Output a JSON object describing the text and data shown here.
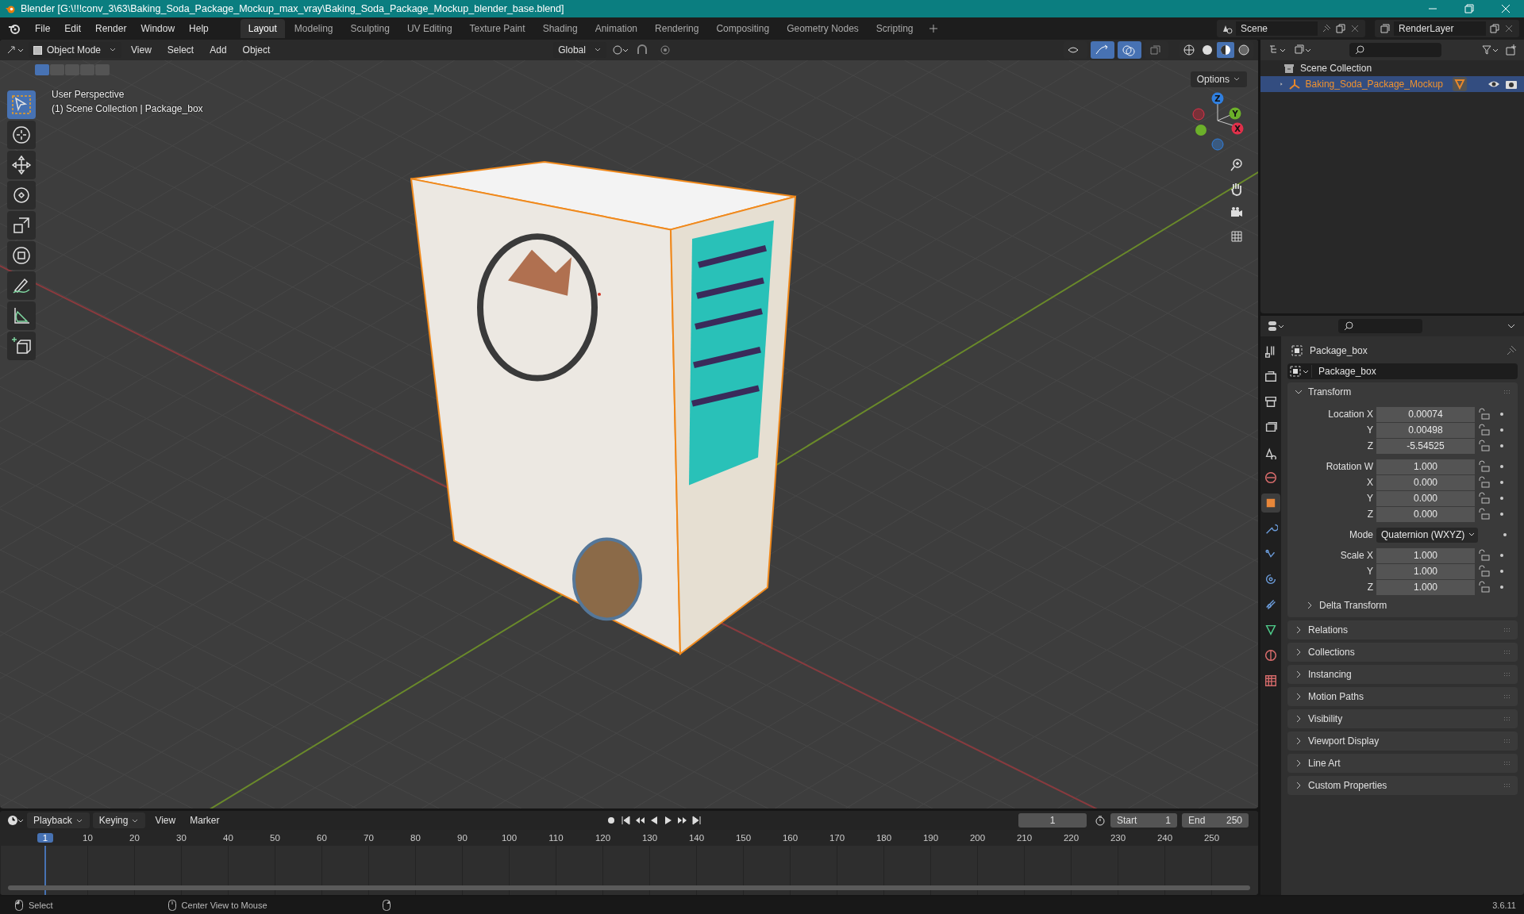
{
  "title_bar": {
    "title": "Blender [G:\\!!!conv_3\\63\\Baking_Soda_Package_Mockup_max_vray\\Baking_Soda_Package_Mockup_blender_base.blend]"
  },
  "menu": [
    "File",
    "Edit",
    "Render",
    "Window",
    "Help"
  ],
  "workspaces": [
    {
      "label": "Layout",
      "selected": true
    },
    {
      "label": "Modeling",
      "selected": false
    },
    {
      "label": "Sculpting",
      "selected": false
    },
    {
      "label": "UV Editing",
      "selected": false
    },
    {
      "label": "Texture Paint",
      "selected": false
    },
    {
      "label": "Shading",
      "selected": false
    },
    {
      "label": "Animation",
      "selected": false
    },
    {
      "label": "Rendering",
      "selected": false
    },
    {
      "label": "Compositing",
      "selected": false
    },
    {
      "label": "Geometry Nodes",
      "selected": false
    },
    {
      "label": "Scripting",
      "selected": false
    }
  ],
  "scene": {
    "name": "Scene"
  },
  "view_layer": {
    "name": "RenderLayer"
  },
  "viewport": {
    "mode": "Object Mode",
    "menus": [
      "View",
      "Select",
      "Add",
      "Object"
    ],
    "orientation": "Global",
    "options": "Options",
    "toggles": [
      {
        "kind": "visibility",
        "on": false
      },
      {
        "kind": "gizmo",
        "on": true
      },
      {
        "kind": "overlay",
        "on": true
      },
      {
        "kind": "xray",
        "on": false
      }
    ],
    "shading": [
      {
        "kind": "wireframe",
        "selected": false
      },
      {
        "kind": "solid",
        "selected": false
      },
      {
        "kind": "material",
        "selected": true
      },
      {
        "kind": "rendered",
        "selected": false
      }
    ],
    "select_modes": [
      {
        "selected": true
      },
      {
        "selected": false
      },
      {
        "selected": false
      },
      {
        "selected": false
      },
      {
        "selected": false
      }
    ],
    "overlay_text": [
      "User Perspective",
      "(1) Scene Collection | Package_box"
    ],
    "tools": [
      {
        "kind": "select",
        "selected": true
      },
      {
        "kind": "cursor",
        "selected": false
      },
      {
        "kind": "move",
        "selected": false
      },
      {
        "kind": "rotate",
        "selected": false
      },
      {
        "kind": "scale",
        "selected": false
      },
      {
        "kind": "transform",
        "selected": false
      },
      {
        "kind": "annotate",
        "selected": false
      },
      {
        "kind": "measure",
        "selected": false
      },
      {
        "kind": "add",
        "selected": false
      }
    ],
    "gizmo_axes": [
      "Z",
      "Y",
      "X"
    ]
  },
  "outliner": {
    "root": "Scene Collection",
    "items": [
      {
        "label": "Baking_Soda_Package_Mockup",
        "expanded": false,
        "selected": true
      }
    ]
  },
  "properties": {
    "tabs": [
      {
        "kind": "tool",
        "selected": false
      },
      {
        "kind": "render",
        "selected": false
      },
      {
        "kind": "output",
        "selected": false
      },
      {
        "kind": "viewlayer",
        "selected": false
      },
      {
        "kind": "scene",
        "selected": false
      },
      {
        "kind": "world",
        "selected": false
      },
      {
        "kind": "object",
        "selected": true
      },
      {
        "kind": "modifiers",
        "selected": false
      },
      {
        "kind": "particles",
        "selected": false
      },
      {
        "kind": "physics",
        "selected": false
      },
      {
        "kind": "constraints",
        "selected": false
      },
      {
        "kind": "data",
        "selected": false
      },
      {
        "kind": "material",
        "selected": false
      },
      {
        "kind": "texture",
        "selected": false
      }
    ],
    "object_name": "Package_box",
    "datablock": "Package_box",
    "transform": {
      "title": "Transform",
      "expanded": true,
      "groups": [
        [
          {
            "kind": "number",
            "label": "Location X",
            "value": "0.00074"
          },
          {
            "kind": "number",
            "label": "Y",
            "value": "0.00498"
          },
          {
            "kind": "number",
            "label": "Z",
            "value": "-5.54525"
          }
        ],
        [
          {
            "kind": "number",
            "label": "Rotation W",
            "value": "1.000"
          },
          {
            "kind": "number",
            "label": "X",
            "value": "0.000"
          },
          {
            "kind": "number",
            "label": "Y",
            "value": "0.000"
          },
          {
            "kind": "number",
            "label": "Z",
            "value": "0.000"
          }
        ],
        [
          {
            "kind": "dropdown",
            "label": "Mode",
            "value": "Quaternion (WXYZ)"
          }
        ],
        [
          {
            "kind": "number",
            "label": "Scale X",
            "value": "1.000"
          },
          {
            "kind": "number",
            "label": "Y",
            "value": "1.000"
          },
          {
            "kind": "number",
            "label": "Z",
            "value": "1.000"
          }
        ]
      ],
      "subpanel": {
        "title": "Delta Transform",
        "expanded": false
      }
    },
    "panels": [
      {
        "title": "Relations",
        "expanded": false
      },
      {
        "title": "Collections",
        "expanded": false
      },
      {
        "title": "Instancing",
        "expanded": false
      },
      {
        "title": "Motion Paths",
        "expanded": false
      },
      {
        "title": "Visibility",
        "expanded": false
      },
      {
        "title": "Viewport Display",
        "expanded": false
      },
      {
        "title": "Line Art",
        "expanded": false
      },
      {
        "title": "Custom Properties",
        "expanded": false
      }
    ]
  },
  "timeline": {
    "menus": [
      "Playback",
      "Keying",
      "View",
      "Marker"
    ],
    "current_frame": "1",
    "start_label": "Start",
    "start": "1",
    "end_label": "End",
    "end": "250",
    "frames": [
      {
        "label": "1",
        "selected": true
      },
      {
        "label": "10",
        "selected": false
      },
      {
        "label": "20",
        "selected": false
      },
      {
        "label": "30",
        "selected": false
      },
      {
        "label": "40",
        "selected": false
      },
      {
        "label": "50",
        "selected": false
      },
      {
        "label": "60",
        "selected": false
      },
      {
        "label": "70",
        "selected": false
      },
      {
        "label": "80",
        "selected": false
      },
      {
        "label": "90",
        "selected": false
      },
      {
        "label": "100",
        "selected": false
      },
      {
        "label": "110",
        "selected": false
      },
      {
        "label": "120",
        "selected": false
      },
      {
        "label": "130",
        "selected": false
      },
      {
        "label": "140",
        "selected": false
      },
      {
        "label": "150",
        "selected": false
      },
      {
        "label": "160",
        "selected": false
      },
      {
        "label": "170",
        "selected": false
      },
      {
        "label": "180",
        "selected": false
      },
      {
        "label": "190",
        "selected": false
      },
      {
        "label": "200",
        "selected": false
      },
      {
        "label": "210",
        "selected": false
      },
      {
        "label": "220",
        "selected": false
      },
      {
        "label": "230",
        "selected": false
      },
      {
        "label": "240",
        "selected": false
      },
      {
        "label": "250",
        "selected": false
      }
    ]
  },
  "status_bar": {
    "hints": [
      "Select",
      "Center View to Mouse"
    ],
    "version": "3.6.11"
  }
}
